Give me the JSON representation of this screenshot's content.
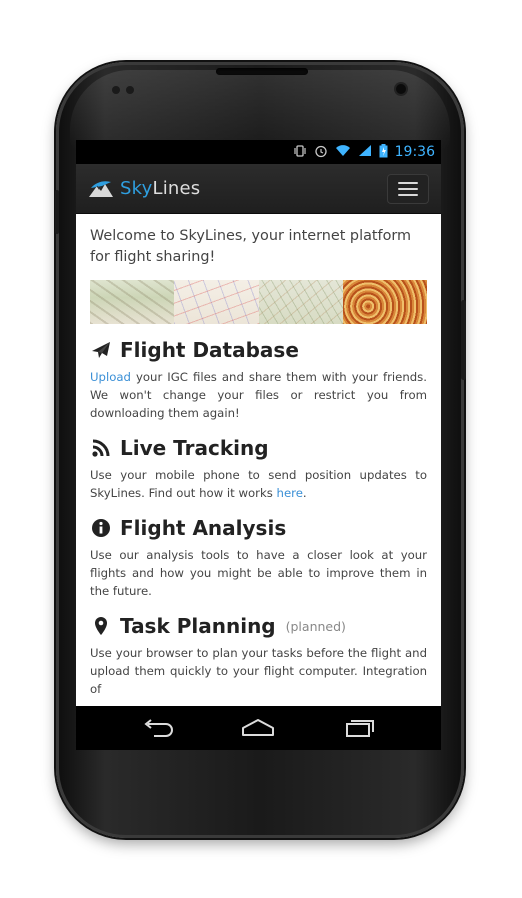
{
  "status_bar": {
    "time": "19:36",
    "icons": [
      "vibrate-icon",
      "alarm-icon",
      "wifi-icon",
      "signal-icon",
      "battery-icon"
    ]
  },
  "app_bar": {
    "brand_sky": "Sky",
    "brand_lines": "Lines",
    "menu_icon": "hamburger-menu-icon",
    "colors": {
      "sky": "#2f9fe0",
      "lines": "#dedede",
      "bar": "#2a2a2a"
    }
  },
  "content": {
    "welcome": "Welcome to SkyLines, your internet platform for flight sharing!",
    "sections": [
      {
        "icon": "plane-icon",
        "title": "Flight Database",
        "note": "",
        "link_text": "Upload",
        "text_before": "",
        "text_after": " your IGC files and share them with your friends. We won't change your files or restrict you from downloading them again!"
      },
      {
        "icon": "rss-icon",
        "title": "Live Tracking",
        "note": "",
        "text_before": "Use your mobile phone to send position updates to SkyLines. Find out how it works ",
        "link_text": "here",
        "text_after": "."
      },
      {
        "icon": "info-icon",
        "title": "Flight Analysis",
        "note": "",
        "text": "Use our analysis tools to have a closer look at your flights and how you might be able to improve them in the future."
      },
      {
        "icon": "map-marker-icon",
        "title": "Task Planning",
        "note": "(planned)",
        "text": "Use your browser to plan your tasks before the flight and upload them quickly to your flight computer. Integration of"
      }
    ]
  },
  "nav_bar": {
    "icons": [
      "back-icon",
      "home-icon",
      "recent-apps-icon"
    ]
  },
  "accent_link_color": "#3a8fd6"
}
